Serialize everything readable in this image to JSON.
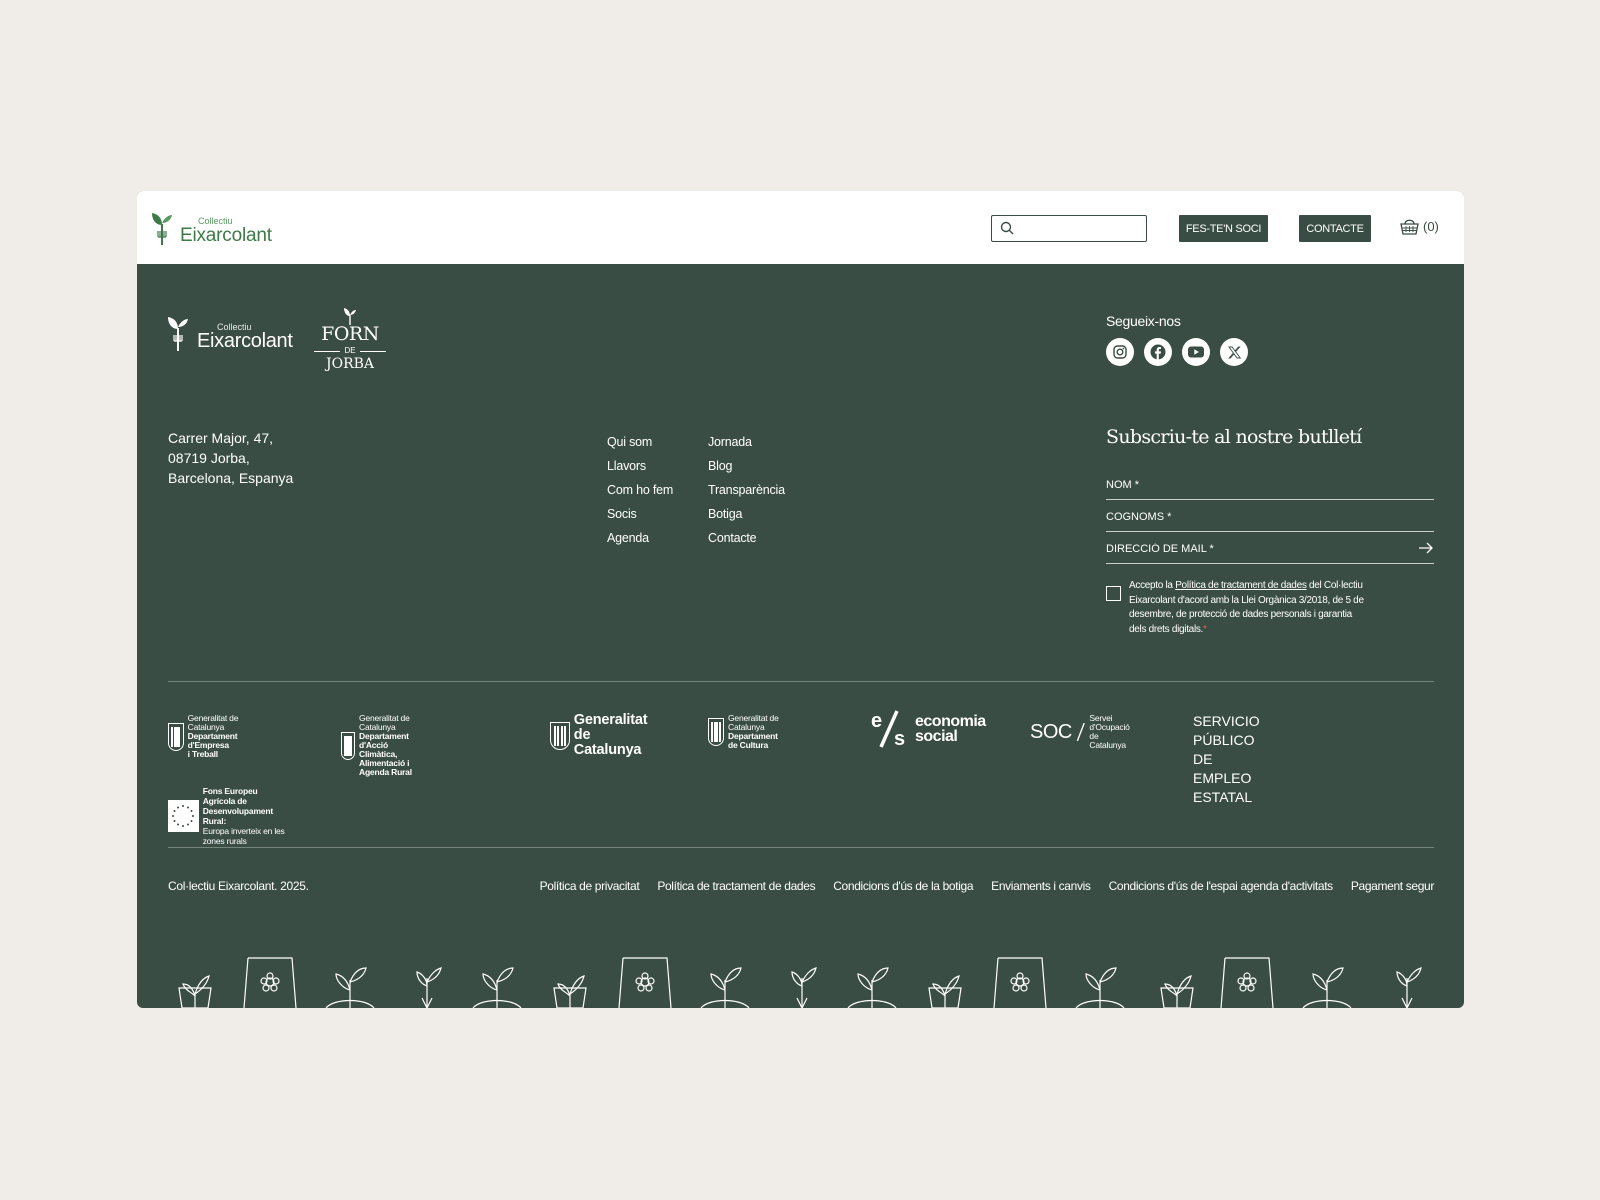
{
  "header": {
    "logo_small": "Collectiu",
    "logo_big": "Eixarcolant",
    "search_placeholder": "",
    "btn_soci": "FES-TE'N SOCI",
    "btn_contacte": "CONTACTE",
    "cart_count": "(0)"
  },
  "footer": {
    "logo_small": "Collectiu",
    "logo_big": "Eixarcolant",
    "forn_line1": "FORN",
    "forn_line2": "DE",
    "forn_line3": "JORBA",
    "address": [
      "Carrer Major, 47,",
      "08719 Jorba,",
      "Barcelona, Espanya"
    ],
    "nav_col1": [
      "Qui som",
      "Llavors",
      "Com ho fem",
      "Socis",
      "Agenda"
    ],
    "nav_col2": [
      "Jornada",
      "Blog",
      "Transparència",
      "Botiga",
      "Contacte"
    ],
    "follow_label": "Segueix-nos",
    "socials": [
      "instagram-icon",
      "facebook-icon",
      "youtube-icon",
      "x-icon"
    ],
    "newsletter": {
      "title": "Subscriu-te al nostre butlletí",
      "nom": "NOM *",
      "cognoms": "COGNOMS *",
      "mail": "DIRECCIÓ DE MAIL *",
      "consent_pre": "Accepto la ",
      "consent_link": "Política de tractament de dades",
      "consent_post": " del Col·lectiu Eixarcolant d'acord amb la Llei Orgànica 3/2018, de 5 de desembre, de protecció de dades personals i garantia dels drets digitals.",
      "required_mark": "*"
    },
    "sponsors": {
      "empresa_l1": "Generalitat de Catalunya",
      "empresa_l2": "Departament d'Empresa",
      "empresa_l3": "i Treball",
      "accio_l1": "Generalitat de Catalunya",
      "accio_l2": "Departament d'Acció Climàtica,",
      "accio_l3": "Alimentació i Agenda Rural",
      "gen_l1": "Generalitat",
      "gen_l2": "de Catalunya",
      "cultura_l1": "Generalitat de Catalunya",
      "cultura_l2": "Departament",
      "cultura_l3": "de Cultura",
      "econ_l1": "economia",
      "econ_l2": "social",
      "soc_main": "SOC",
      "soc_l1": "Servei d'Ocupació",
      "soc_l2": "de Catalunya",
      "sepe_l1": "SERVICIO PÚBLICO",
      "sepe_l2": "DE EMPLEO ESTATAL",
      "feader_l1": "Fons Europeu Agrícola de",
      "feader_l2": "Desenvolupament Rural:",
      "feader_l3": "Europa inverteix en les zones rurals"
    },
    "copyright": "Col·lectiu Eixarcolant.  2025.",
    "legal_links": [
      "Política de privacitat",
      "Política de tractament de dades",
      "Condicions d'ús de la botiga",
      "Enviaments i canvis",
      "Condicions d'ús de l'espai agenda d'activitats",
      "Pagament segur"
    ]
  },
  "colors": {
    "footer_bg": "#3a4d44",
    "page_bg": "#f0ede8",
    "brand_green": "#3e7a48"
  }
}
